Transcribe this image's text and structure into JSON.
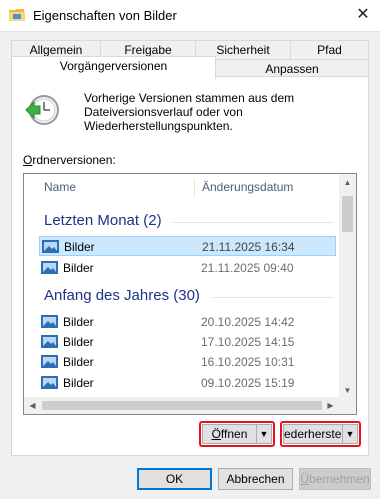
{
  "window": {
    "title": "Eigenschaften von Bilder",
    "close_glyph": "✕"
  },
  "tabs": {
    "row1": [
      "Allgemein",
      "Freigabe",
      "Sicherheit",
      "Pfad"
    ],
    "row2": [
      "Vorgängerversionen",
      "Anpassen"
    ],
    "active": "Vorgängerversionen"
  },
  "description": "Vorherige Versionen stammen aus dem Dateiversionsverlauf oder von Wiederherstellungspunkten.",
  "section_label": {
    "accel": "O",
    "rest": "rdnerversionen:"
  },
  "list": {
    "columns": [
      "Name",
      "Änderungsdatum"
    ],
    "groups": [
      {
        "title": "Letzten Monat (2)",
        "rows": [
          {
            "name": "Bilder",
            "date": "21.11.2025 16:34",
            "selected": true
          },
          {
            "name": "Bilder",
            "date": "21.11.2025 09:40",
            "selected": false
          }
        ]
      },
      {
        "title": "Anfang des Jahres (30)",
        "rows": [
          {
            "name": "Bilder",
            "date": "20.10.2025 14:42",
            "selected": false
          },
          {
            "name": "Bilder",
            "date": "17.10.2025 14:15",
            "selected": false
          },
          {
            "name": "Bilder",
            "date": "16.10.2025 10:31",
            "selected": false
          },
          {
            "name": "Bilder",
            "date": "09.10.2025 15:19",
            "selected": false
          }
        ]
      }
    ]
  },
  "buttons": {
    "open": {
      "label_pre": "",
      "accel": "Ö",
      "label_post": "ffnen"
    },
    "restore": {
      "label": "ederherstell"
    },
    "dropdown_arrow": "▼",
    "ok": "OK",
    "cancel": "Abbrechen",
    "apply": {
      "accel": "Ü",
      "rest": "bernehmen"
    }
  },
  "icons": {
    "title": "folder-icon",
    "history": "clock-restore-icon",
    "row": "folder-pictures-icon"
  },
  "colors": {
    "highlight_border": "#e81123",
    "selection": "#cce8ff",
    "group_title": "#1e3287",
    "accent": "#0078d7"
  }
}
